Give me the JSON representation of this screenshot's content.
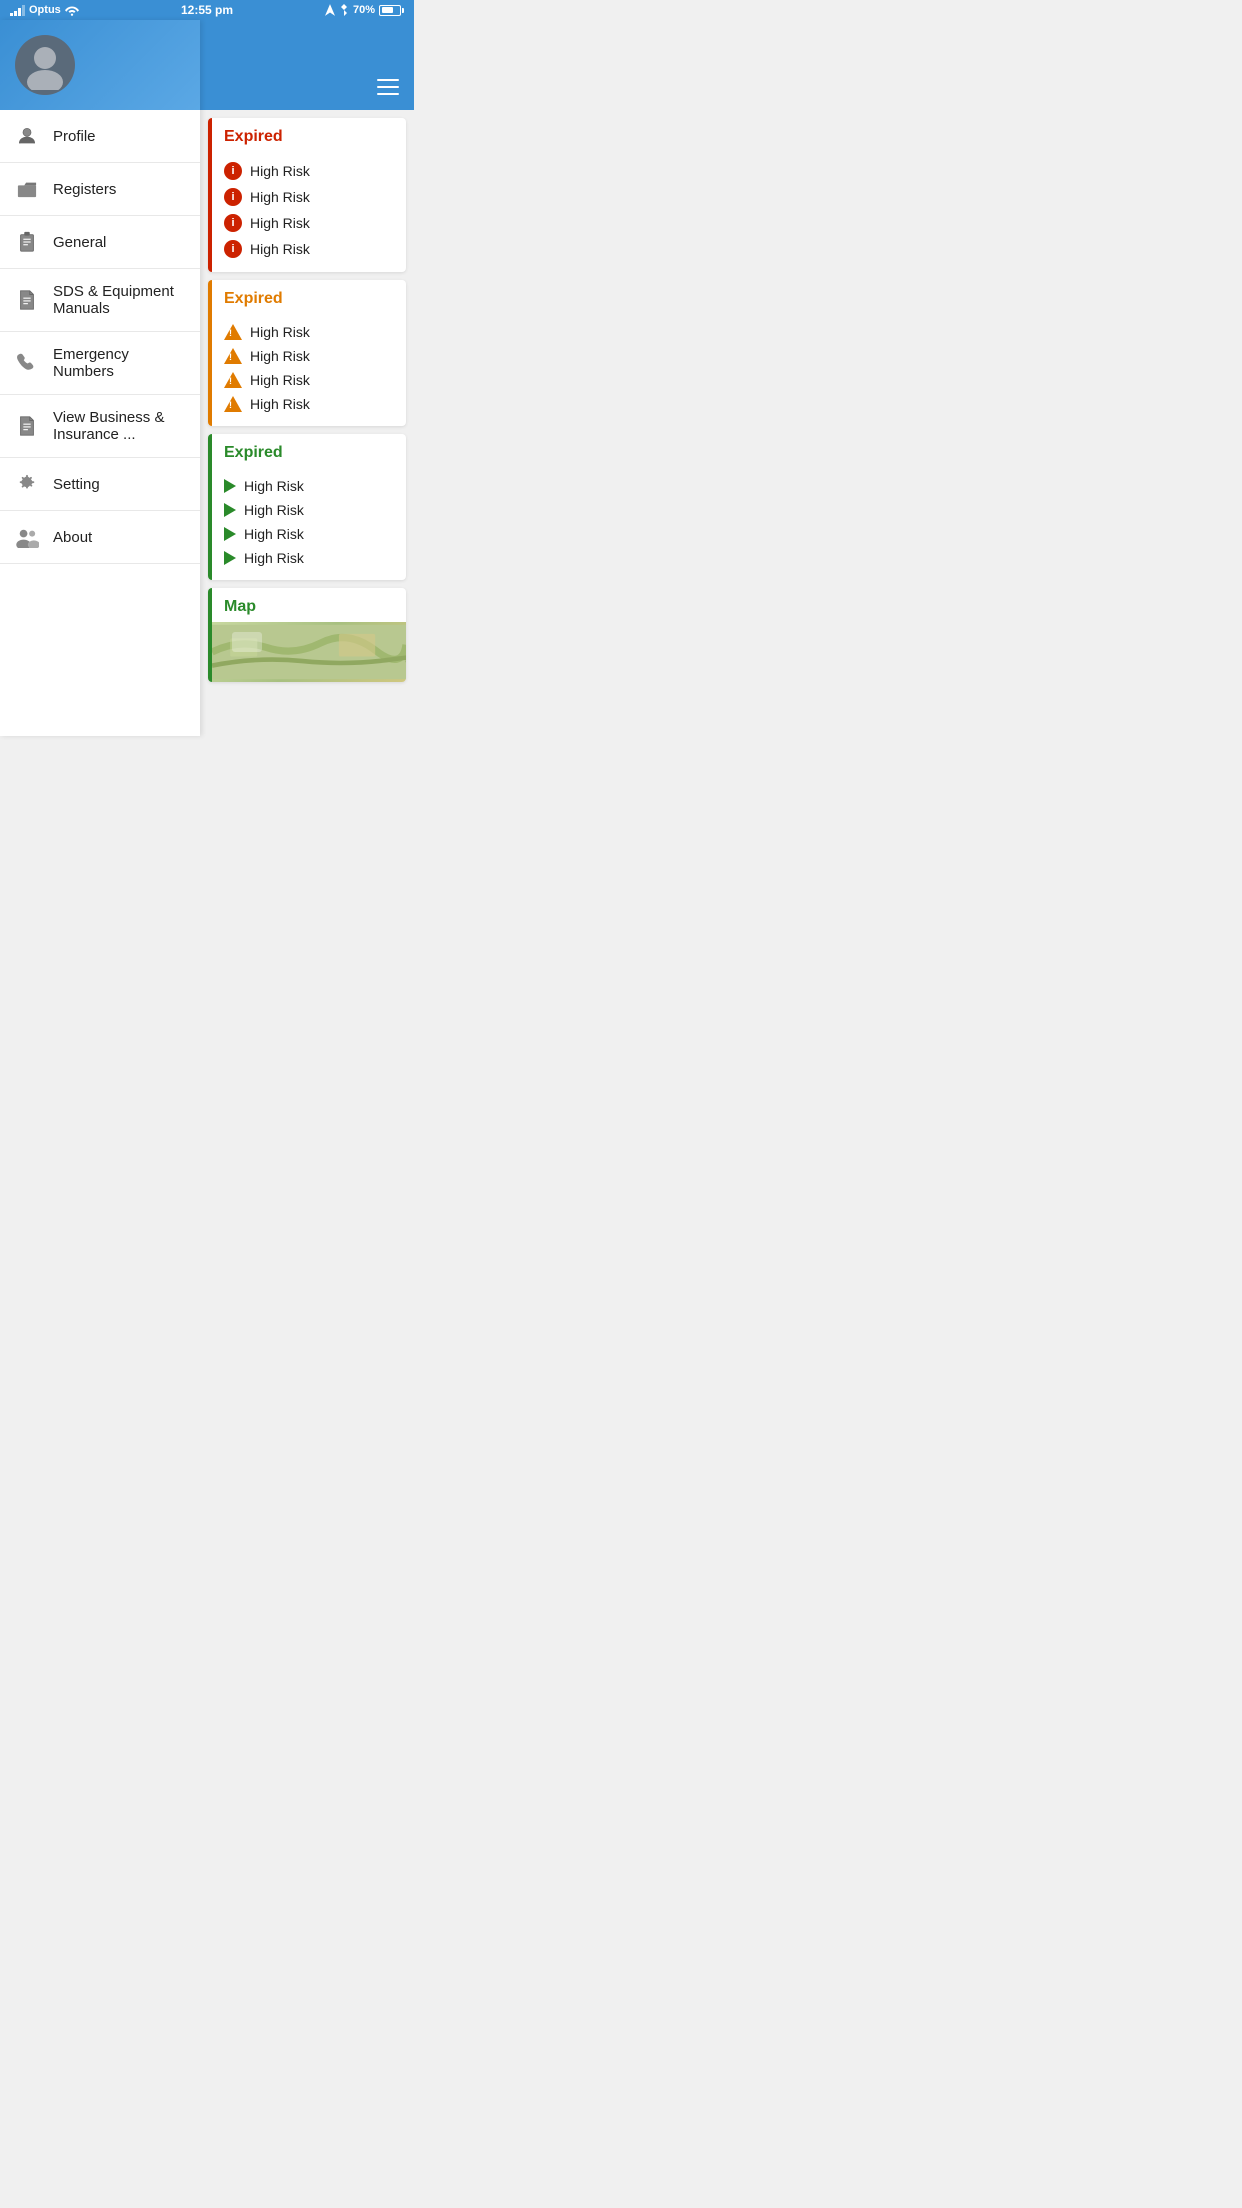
{
  "statusBar": {
    "carrier": "Optus",
    "time": "12:55 pm",
    "battery": "70%"
  },
  "sidebar": {
    "menuItems": [
      {
        "id": "profile",
        "label": "Profile",
        "icon": "person"
      },
      {
        "id": "registers",
        "label": "Registers",
        "icon": "folder"
      },
      {
        "id": "general",
        "label": "General",
        "icon": "clipboard"
      },
      {
        "id": "sds",
        "label": "SDS & Equipment Manuals",
        "icon": "document"
      },
      {
        "id": "emergency",
        "label": "Emergency Numbers",
        "icon": "phone"
      },
      {
        "id": "business",
        "label": "View Business & Insurance ...",
        "icon": "document2"
      },
      {
        "id": "setting",
        "label": "Setting",
        "icon": "gear"
      },
      {
        "id": "about",
        "label": "About",
        "icon": "person-group"
      }
    ]
  },
  "rightPanel": {
    "cards": [
      {
        "id": "card-red",
        "status": "Expired",
        "colorClass": "red",
        "items": [
          "High Risk",
          "High Risk",
          "High Risk",
          "High Risk"
        ]
      },
      {
        "id": "card-orange",
        "status": "Expired",
        "colorClass": "orange",
        "items": [
          "High Risk",
          "High Risk",
          "High Risk",
          "High Risk"
        ]
      },
      {
        "id": "card-green",
        "status": "Expired",
        "colorClass": "green",
        "items": [
          "High Risk",
          "High Risk",
          "High Risk",
          "High Risk"
        ]
      },
      {
        "id": "card-map",
        "status": "Map",
        "colorClass": "green"
      }
    ]
  }
}
